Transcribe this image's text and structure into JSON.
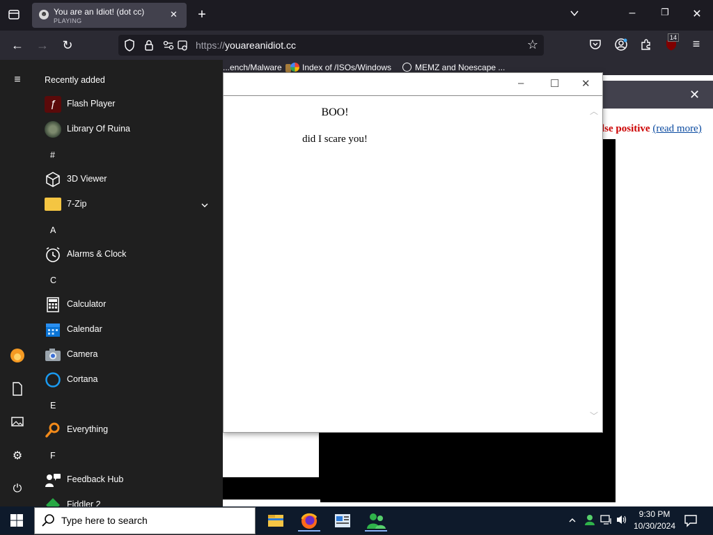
{
  "browser": {
    "tab_title": "You are an Idiot! (dot cc)",
    "tab_status": "PLAYING",
    "url_scheme": "https://",
    "url_host": "youareanidiot.cc",
    "extension_badge": "14",
    "bookmarks": [
      {
        "label": "...ench/Malware",
        "icon": "folder-icon"
      },
      {
        "label": "Index of /ISOs/Windows",
        "icon": "google-icon"
      },
      {
        "label": "MEMZ and Noescape ...",
        "icon": "globe-icon"
      }
    ]
  },
  "page": {
    "warning_red": "lse positive",
    "warning_link": "(read more)"
  },
  "popup": {
    "line1": "BOO!",
    "line2": "did I scare you!"
  },
  "start_menu": {
    "header": "Recently added",
    "recent": [
      {
        "label": "Flash Player",
        "icon": "flash-icon"
      },
      {
        "label": "Library Of Ruina",
        "icon": "game-icon"
      }
    ],
    "groups": [
      {
        "letter": "#",
        "items": [
          {
            "label": "3D Viewer",
            "icon": "cube-icon"
          },
          {
            "label": "7-Zip",
            "icon": "folder-icon",
            "expandable": true
          }
        ]
      },
      {
        "letter": "A",
        "items": [
          {
            "label": "Alarms & Clock",
            "icon": "clock-icon"
          }
        ]
      },
      {
        "letter": "C",
        "items": [
          {
            "label": "Calculator",
            "icon": "calculator-icon"
          },
          {
            "label": "Calendar",
            "icon": "calendar-icon"
          },
          {
            "label": "Camera",
            "icon": "camera-icon"
          },
          {
            "label": "Cortana",
            "icon": "cortana-icon"
          }
        ]
      },
      {
        "letter": "E",
        "items": [
          {
            "label": "Everything",
            "icon": "magnifier-icon"
          }
        ]
      },
      {
        "letter": "F",
        "items": [
          {
            "label": "Feedback Hub",
            "icon": "feedback-icon"
          },
          {
            "label": "Fiddler 2",
            "icon": "fiddler-icon"
          }
        ]
      }
    ]
  },
  "taskbar": {
    "search_placeholder": "Type here to search",
    "time": "9:30 PM",
    "date": "10/30/2024"
  }
}
